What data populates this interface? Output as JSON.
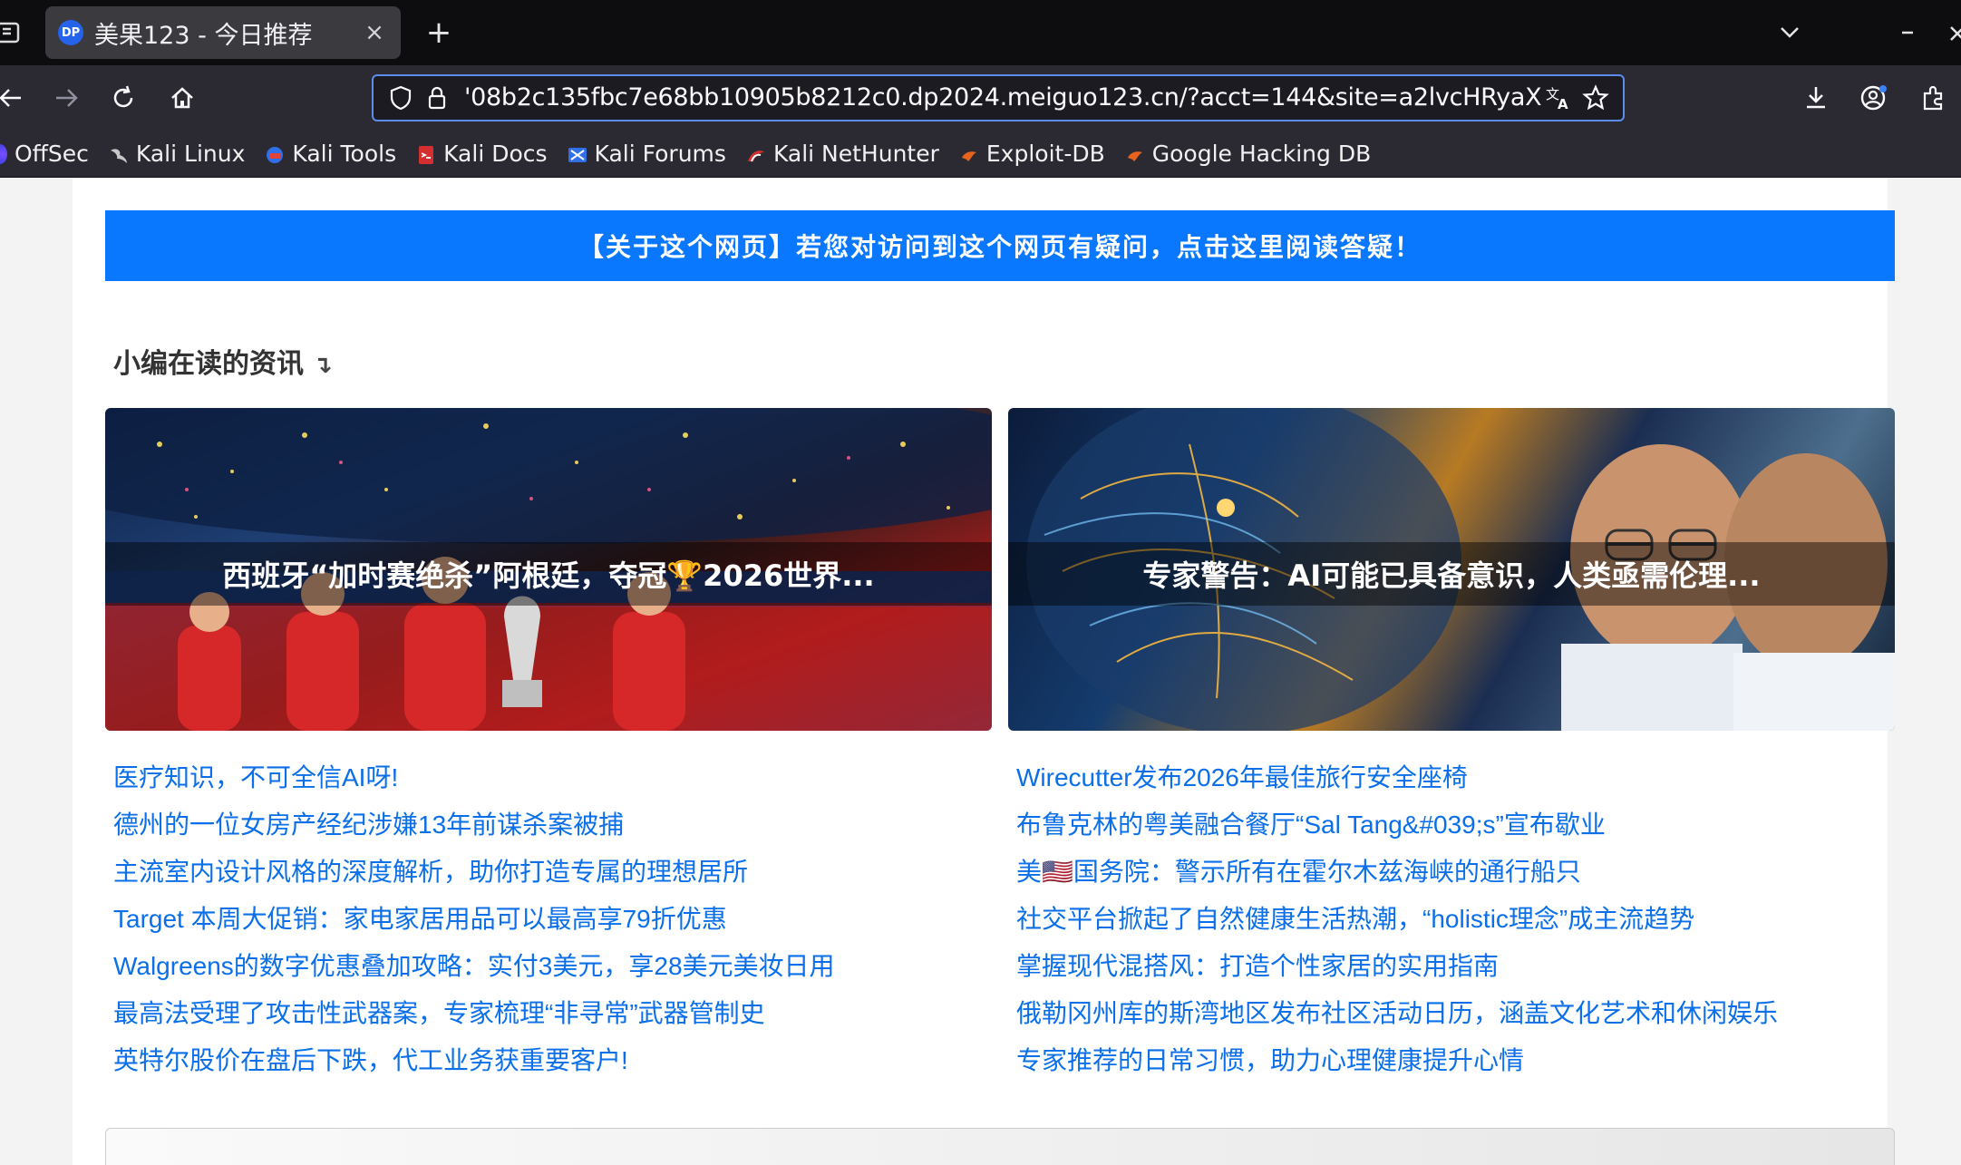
{
  "browser": {
    "tab": {
      "title": "美果123 - 今日推荐",
      "favicon_text": "DP",
      "close_symbol": "×"
    },
    "new_tab_symbol": "+",
    "url": "'08b2c135fbc7e68bb10905b8212c0.dp2024.meiguo123.cn/?acct=144&site=a2lvcHRyaXgzLmNvb",
    "bookmarks": [
      {
        "label": "OffSec",
        "color": "#4b6ef5"
      },
      {
        "label": "Kali Linux",
        "color": "#bbbbbb"
      },
      {
        "label": "Kali Tools",
        "color": "#e0433c"
      },
      {
        "label": "Kali Docs",
        "color": "#d32f2f"
      },
      {
        "label": "Kali Forums",
        "color": "#2f6fe8"
      },
      {
        "label": "Kali NetHunter",
        "color": "#d13030"
      },
      {
        "label": "Exploit-DB",
        "color": "#e8641e"
      },
      {
        "label": "Google Hacking DB",
        "color": "#e8641e"
      }
    ]
  },
  "page": {
    "notice": "【关于这个网页】若您对访问到这个网页有疑问，点击这里阅读答疑！",
    "section_title": "小编在读的资讯",
    "section_arrow": "↴",
    "featured": [
      {
        "caption": "西班牙“加时赛绝杀”阿根廷，夺冠🏆2026世界..."
      },
      {
        "caption": "专家警告：AI可能已具备意识，人类亟需伦理..."
      }
    ],
    "links_left": [
      "医疗知识，不可全信AI呀!",
      "德州的一位女房产经纪涉嫌13年前谋杀案被捕",
      "主流室内设计风格的深度解析，助你打造专属的理想居所",
      "Target 本周大促销：家电家居用品可以最高享79折优惠",
      "Walgreens的数字优惠叠加攻略：实付3美元，享28美元美妆日用",
      "最高法受理了攻击性武器案，专家梳理“非寻常”武器管制史",
      "英特尔股价在盘后下跌，代工业务获重要客户!"
    ],
    "links_right": [
      "Wirecutter发布2026年最佳旅行安全座椅",
      "布鲁克林的粤美融合餐厅“Sal Tang&#039;s”宣布歇业",
      "美🇺🇸国务院：警示所有在霍尔木兹海峡的通行船只",
      "社交平台掀起了自然健康生活热潮，“holistic理念”成主流趋势",
      "掌握现代混搭风：打造个性家居的实用指南",
      "俄勒冈州库的斯湾地区发布社区活动日历，涵盖文化艺术和休闲娱乐",
      "专家推荐的日常习惯，助力心理健康提升心情"
    ]
  }
}
